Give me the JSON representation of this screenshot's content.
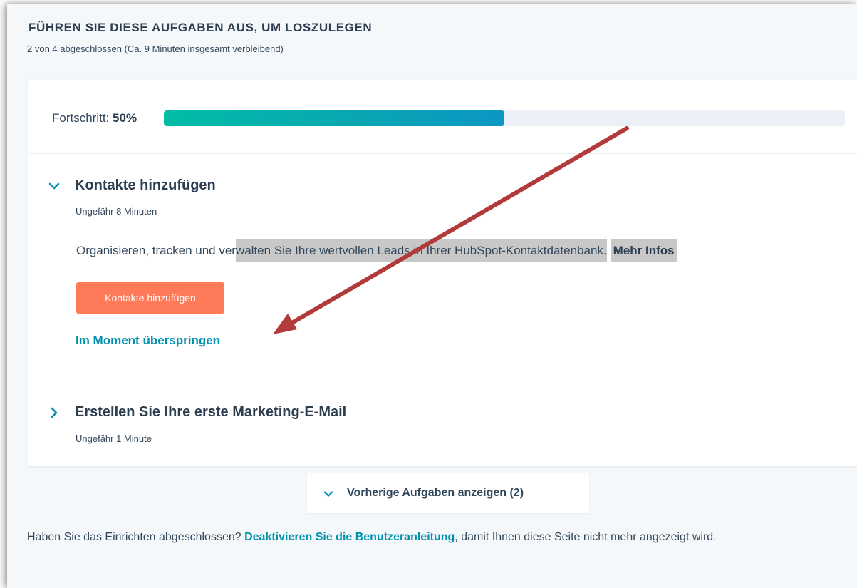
{
  "header": {
    "title": "FÜHREN SIE DIESE AUFGABEN AUS, UM LOSZULEGEN",
    "subtitle": "2 von 4 abgeschlossen (Ca. 9 Minuten insgesamt verbleibend)"
  },
  "progress": {
    "label": "Fortschritt:",
    "value_text": "50%",
    "fraction": 0.5
  },
  "tasks": [
    {
      "title": "Kontakte hinzufügen",
      "meta": "Ungefähr 8 Minuten",
      "expanded": true,
      "description_plain": "Organisieren, tracken und ver",
      "description_highlighted": "walten Sie Ihre wertvollen Leads in Ihrer HubSpot-Kontaktdatenbank.",
      "more_link": "Mehr Infos",
      "primary_button": "Kontakte hinzufügen",
      "skip_link": "Im Moment überspringen"
    },
    {
      "title": "Erstellen Sie Ihre erste Marketing-E-Mail",
      "meta": "Ungefähr 1 Minute",
      "expanded": false
    }
  ],
  "show_previous": {
    "label": "Vorherige Aufgaben anzeigen (2)"
  },
  "footer": {
    "before": "Haben Sie das Einrichten abgeschlossen?",
    "link": "Deaktivieren Sie die Benutzeranleitung",
    "after": ", damit Ihnen diese Seite nicht mehr angezeigt wird."
  },
  "colors": {
    "accent_link": "#0091ae",
    "primary_button": "#ff7a59",
    "progress_fill": "#00bda5",
    "progress_track": "#eaf0f6",
    "annotation_arrow": "#b23a3a",
    "text": "#33475b"
  },
  "icons": {
    "expanded_chevron": "chevron-down-icon",
    "collapsed_chevron": "chevron-right-icon",
    "show_previous_chevron": "chevron-down-icon",
    "annotation": "red-arrow-annotation"
  }
}
